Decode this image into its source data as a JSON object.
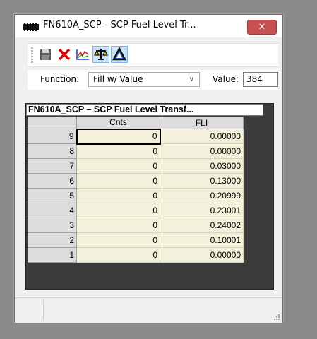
{
  "window": {
    "title": "FN610A_SCP - SCP Fuel Level Tr...",
    "close_label": "✕"
  },
  "toolbar": {
    "buttons": [
      {
        "name": "save",
        "icon": "save-icon"
      },
      {
        "name": "cancel",
        "icon": "delete-x-icon"
      },
      {
        "name": "graph",
        "icon": "graph-icon"
      },
      {
        "name": "balance",
        "icon": "scale-icon"
      },
      {
        "name": "triangle",
        "icon": "triangle-icon"
      }
    ]
  },
  "function_bar": {
    "function_label": "Function:",
    "function_value": "Fill w/ Value",
    "value_label": "Value:",
    "value": "384"
  },
  "grid": {
    "title": "FN610A_SCP – SCP Fuel Level Transf...",
    "columns": [
      "Cnts",
      "FLI"
    ],
    "rows": [
      {
        "num": "9",
        "cnts": "0",
        "fli": "0.00000"
      },
      {
        "num": "8",
        "cnts": "0",
        "fli": "0.00000"
      },
      {
        "num": "7",
        "cnts": "0",
        "fli": "0.03000"
      },
      {
        "num": "6",
        "cnts": "0",
        "fli": "0.13000"
      },
      {
        "num": "5",
        "cnts": "0",
        "fli": "0.20999"
      },
      {
        "num": "4",
        "cnts": "0",
        "fli": "0.23001"
      },
      {
        "num": "3",
        "cnts": "0",
        "fli": "0.24002"
      },
      {
        "num": "2",
        "cnts": "0",
        "fli": "0.10001"
      },
      {
        "num": "1",
        "cnts": "0",
        "fli": "0.00000"
      }
    ]
  }
}
